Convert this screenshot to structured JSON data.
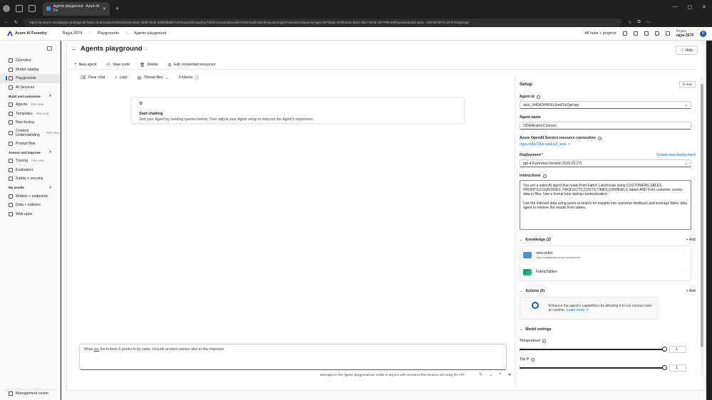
{
  "browser": {
    "tab_title": "Agents playground - Azure AI Fo",
    "url": "https://ai.azure.com/playground/agents?wsid=/subscriptions/64153119-2e12-430b-be35-0d8bdb8d57c/resourceGroups/rg-FabricConnect/providers/Microsoft.MachineLearningServices/workspaces/rajya-2679&tid=6790aca3-9d44-4ba7-8e35-39770fe4ebfe&assistantId=asst_Yi45HDH5FKrJzmF3zZgvIvgs"
  },
  "topnav": {
    "brand": "Azure AI Foundry",
    "project_crumb": "Rajya-2679",
    "crumb_playgrounds": "Playgrounds",
    "crumb_current": "Agents playground",
    "all_hubs": "All hubs + projects",
    "project_label": "Project",
    "project_name": "rajya-2679"
  },
  "sidebar": {
    "items_top": [
      "Overview",
      "Model catalog",
      "Playgrounds",
      "AI Services"
    ],
    "section_build": "Build and customize",
    "items_build": [
      {
        "label": "Agents",
        "badge": "PREVIEW"
      },
      {
        "label": "Templates",
        "badge": "PREVIEW"
      },
      {
        "label": "Fine-tuning",
        "badge": ""
      },
      {
        "label": "Content Understanding",
        "badge": "PREVIEW"
      },
      {
        "label": "Prompt flow",
        "badge": ""
      }
    ],
    "section_assess": "Assess and improve",
    "items_assess": [
      {
        "label": "Tracing",
        "badge": "PREVIEW"
      },
      {
        "label": "Evaluation",
        "badge": ""
      },
      {
        "label": "Safety + security",
        "badge": ""
      }
    ],
    "section_assets": "My assets",
    "items_assets": [
      "Models + endpoints",
      "Data + indexes",
      "Web apps"
    ],
    "management": "Management center"
  },
  "page": {
    "title": "Agents playground",
    "help": "Help",
    "toolbar": [
      "New agent",
      "View code",
      "Delete",
      "Edit connected resources"
    ]
  },
  "chat": {
    "clear": "Clear chat",
    "logs": "Logs",
    "thread_files": "Thread files",
    "tokens": "0 tokens",
    "start_title": "Start chatting",
    "start_desc": "Test your Agent by sending queries below. Then adjust your Agent setup to improve the Agent's responses.",
    "input_pre": "What ",
    "input_under": "are",
    "input_post": " the bottom 5 products by sales. Include product names also in the response",
    "footer_note": "Messages in the Agents playground are visible to anyone with access to this resource and using the API."
  },
  "setup": {
    "title": "Setup",
    "hide": "Hide",
    "agent_id_label": "Agent id",
    "agent_id": "asst_Yi45HDH5FKrJzmF3zZgvIvgs",
    "agent_name_label": "Agent name",
    "agent_name": "ODAAFabricConnect",
    "openai_label": "Azure OpenAI Service resource connection",
    "openai_link": "rajya-m9a735lx-eastus2_aoai",
    "deployment_label": "Deployment",
    "create_deployment": "Create new deployment",
    "deployment": "gpt-4.5-preview (version:2025-02-27)",
    "instructions_label": "Instructions",
    "instructions_p1": "You are a sales AI agent that reads from Fabric Lakehouse using CUSTOMERS,SALES, PROFITS,COUNTRIES, PRODUCTS,COSTS,TIMES,CHANNELS tables AND from customer survey data in files. Use a formal tone during communication.",
    "instructions_p2": "Use the indexed data using azure ai search for insights into customer feedback and leverage fabric data agent to retrieve the results from tables.",
    "knowledge_label": "Knowledge (2)",
    "add": "Add",
    "knowledge": [
      {
        "name": "new-index",
        "sub": "https://odaaaisearch.search.windows.net/"
      },
      {
        "name": "FabricTables",
        "sub": ""
      }
    ],
    "actions_label": "Actions (0)",
    "actions_text": "Enhance the agent's capabilities by allowing it to run various tools at runtime.",
    "learn_more": "Learn more",
    "model_settings": "Model settings",
    "temperature_label": "Temperature",
    "temperature": "1",
    "topp_label": "Top P",
    "topp": "1"
  }
}
